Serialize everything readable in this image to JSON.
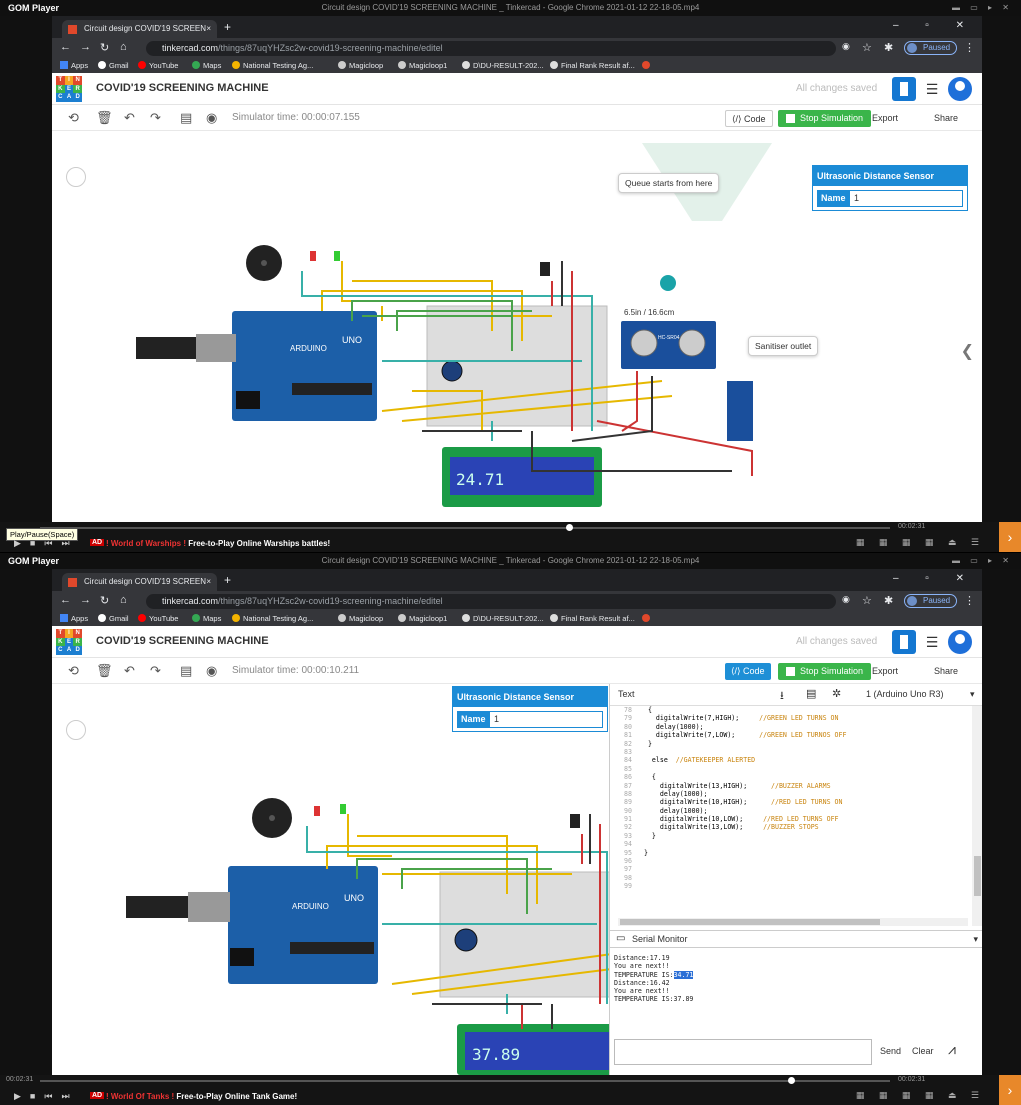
{
  "panels": [
    {
      "gom": {
        "app_name": "GOM Player",
        "title": "Circuit design COVID'19 SCREENING MACHINE _ Tinkercad - Google Chrome 2021-01-12 22-18-05.mp4",
        "time_left": "",
        "time_right": "00:02:31",
        "tooltip": "Play/Pause(Space)",
        "ad_badge": "AD",
        "ad_part1": "! World of Warships !",
        "ad_part2": " Free-to-Play Online Warships battles!"
      },
      "browser": {
        "tab_title": "Circuit design COVID'19 SCREEN",
        "url_host": "tinkercad.com",
        "url_path": "/things/87uqYHZsc2w-covid19-screening-machine/editel",
        "profile_status": "Paused"
      },
      "bookmarks": [
        "Apps",
        "Gmail",
        "YouTube",
        "Maps",
        "National Testing Ag...",
        "Magicloop",
        "Magicloop1",
        "D\\DU-RESULT-202...",
        "Final Rank Result af..."
      ],
      "tinkercad": {
        "logo_letters": [
          "T",
          "I",
          "N",
          "K",
          "E",
          "R",
          "C",
          "A",
          "D"
        ],
        "project_title": "COVID'19 SCREENING MACHINE",
        "save_status": "All changes saved",
        "sim_time": "Simulator time: 00:00:07.155",
        "code_label": "Code",
        "stop_label": "Stop Simulation",
        "export_label": "Export",
        "share_label": "Share"
      },
      "sensor_panel": {
        "title": "Ultrasonic Distance Sensor",
        "name_label": "Name",
        "name_value": "1"
      },
      "circuit": {
        "lcd_text": "24.71",
        "distance_label": "6.5in / 16.6cm",
        "queue_note": "Queue starts from here",
        "sanitiser_note": "Sanitiser outlet",
        "sensor_model": "HC-SR04",
        "arduino_label": "UNO",
        "arduino_brand": "ARDUINO"
      }
    },
    {
      "gom": {
        "app_name": "GOM Player",
        "title": "Circuit design COVID'19 SCREENING MACHINE _ Tinkercad - Google Chrome 2021-01-12 22-18-05.mp4",
        "time_left": "00:02:31",
        "time_right": "00:02:31",
        "ad_badge": "AD",
        "ad_part1": "! World Of Tanks !",
        "ad_part2": " Free-to-Play Online Tank Game!"
      },
      "browser": {
        "tab_title": "Circuit design COVID'19 SCREEN",
        "url_host": "tinkercad.com",
        "url_path": "/things/87uqYHZsc2w-covid19-screening-machine/editel",
        "profile_status": "Paused"
      },
      "bookmarks": [
        "Apps",
        "Gmail",
        "YouTube",
        "Maps",
        "National Testing Ag...",
        "Magicloop",
        "Magicloop1",
        "D\\DU-RESULT-202...",
        "Final Rank Result af..."
      ],
      "tinkercad": {
        "logo_letters": [
          "T",
          "I",
          "N",
          "K",
          "E",
          "R",
          "C",
          "A",
          "D"
        ],
        "project_title": "COVID'19 SCREENING MACHINE",
        "save_status": "All changes saved",
        "sim_time": "Simulator time: 00:00:10.211",
        "code_label": "Code",
        "stop_label": "Stop Simulation",
        "export_label": "Export",
        "share_label": "Share"
      },
      "sensor_panel": {
        "title": "Ultrasonic Distance Sensor",
        "name_label": "Name",
        "name_value": "1"
      },
      "circuit": {
        "lcd_text": "37.89",
        "arduino_label": "UNO",
        "arduino_brand": "ARDUINO"
      },
      "code_panel": {
        "mode": "Text",
        "board": "1 (Arduino Uno R3)",
        "lines": [
          {
            "n": "78",
            "code": "  {",
            "comment": ""
          },
          {
            "n": "79",
            "code": "    digitalWrite(7,HIGH);     ",
            "comment": "//GREEN LED TURNS ON"
          },
          {
            "n": "80",
            "code": "    delay(1000);",
            "comment": ""
          },
          {
            "n": "81",
            "code": "    digitalWrite(7,LOW);      ",
            "comment": "//GREEN LED TURNOS OFF"
          },
          {
            "n": "82",
            "code": "  }",
            "comment": ""
          },
          {
            "n": "83",
            "code": "",
            "comment": ""
          },
          {
            "n": "84",
            "code": "   else  ",
            "comment": "//GATEKEEPER ALERTED"
          },
          {
            "n": "85",
            "code": "",
            "comment": ""
          },
          {
            "n": "86",
            "code": "   {",
            "comment": ""
          },
          {
            "n": "87",
            "code": "     digitalWrite(13,HIGH);      ",
            "comment": "//BUZZER ALARMS"
          },
          {
            "n": "88",
            "code": "     delay(1000);",
            "comment": ""
          },
          {
            "n": "89",
            "code": "     digitalWrite(10,HIGH);      ",
            "comment": "//RED LED TURNS ON"
          },
          {
            "n": "90",
            "code": "     delay(1000);",
            "comment": ""
          },
          {
            "n": "91",
            "code": "     digitalWrite(10,LOW);     ",
            "comment": "//RED LED TURNS OFF"
          },
          {
            "n": "92",
            "code": "     digitalWrite(13,LOW);     ",
            "comment": "//BUZZER STOPS"
          },
          {
            "n": "93",
            "code": "   }",
            "comment": ""
          },
          {
            "n": "94",
            "code": "",
            "comment": ""
          },
          {
            "n": "95",
            "code": " }",
            "comment": ""
          },
          {
            "n": "96",
            "code": "",
            "comment": ""
          },
          {
            "n": "97",
            "code": "",
            "comment": ""
          },
          {
            "n": "98",
            "code": "",
            "comment": ""
          },
          {
            "n": "99",
            "code": "",
            "comment": ""
          }
        ],
        "serial_title": "Serial Monitor",
        "serial_lines": [
          {
            "text": "Distance:17.19",
            "hl": ""
          },
          {
            "text": "You are next!!",
            "hl": ""
          },
          {
            "text": "TEMPERATURE IS:",
            "hl": "34.71"
          },
          {
            "text": "Distance:16.42",
            "hl": ""
          },
          {
            "text": "You are next!!",
            "hl": ""
          },
          {
            "text": "TEMPERATURE IS:37.89",
            "hl": ""
          }
        ],
        "send_label": "Send",
        "clear_label": "Clear"
      }
    }
  ]
}
